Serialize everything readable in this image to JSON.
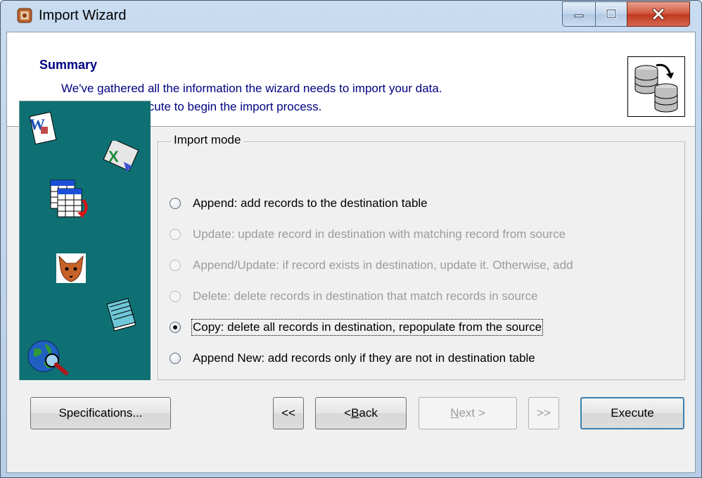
{
  "window": {
    "title": "Import Wizard",
    "icons": {
      "app": "import-wizard-app-icon",
      "minimize": "minimize-icon",
      "maximize": "maximize-icon",
      "close": "close-icon"
    }
  },
  "header": {
    "title": "Summary",
    "line1": "We've gathered all the information the wizard needs to import your data.",
    "line2": "Please click Execute to begin the import process.",
    "icon": "database-import-icon"
  },
  "side_panel": {
    "icons": [
      "word-document-icon",
      "excel-spreadsheet-icon",
      "table-import-icon",
      "foxpro-icon",
      "notepad-icon",
      "globe-search-icon"
    ]
  },
  "import_mode": {
    "label": "Import mode",
    "options": [
      {
        "label": "Append: add records to the destination table",
        "enabled": true,
        "checked": false
      },
      {
        "label": "Update: update record in destination with matching record from source",
        "enabled": false,
        "checked": false
      },
      {
        "label": "Append/Update: if record exists in destination, update it. Otherwise, add",
        "enabled": false,
        "checked": false
      },
      {
        "label": "Delete: delete records in destination that match records in source",
        "enabled": false,
        "checked": false
      },
      {
        "label": "Copy: delete all records in destination, repopulate from the source",
        "enabled": true,
        "checked": true
      },
      {
        "label": "Append New: add records only if they are not in destination table",
        "enabled": true,
        "checked": false
      }
    ]
  },
  "buttons": {
    "specifications": "Specifications...",
    "first": "<<",
    "back_prefix": "< ",
    "back_mnemonic": "B",
    "back_rest": "ack",
    "next_mnemonic": "N",
    "next_rest": "ext >",
    "last": ">>",
    "execute": "Execute"
  },
  "colors": {
    "accent_text": "#000080",
    "side_panel": "#0f7073",
    "disabled_text": "#9c9c9c"
  }
}
